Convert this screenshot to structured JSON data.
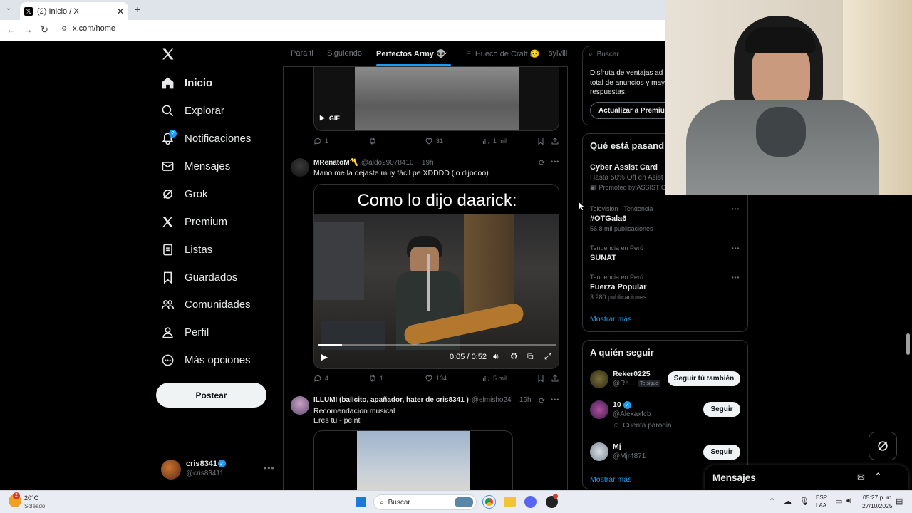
{
  "browser": {
    "tab_title": "(2) Inicio / X",
    "url": "x.com/home"
  },
  "nav": {
    "items": [
      "Inicio",
      "Explorar",
      "Notificaciones",
      "Mensajes",
      "Grok",
      "Premium",
      "Listas",
      "Guardados",
      "Comunidades",
      "Perfil",
      "Más opciones"
    ],
    "notif_badge": "2",
    "post_label": "Postear"
  },
  "account": {
    "name": "cris8341",
    "handle": "@cris83411"
  },
  "timeline_tabs": [
    "Para ti",
    "Siguiendo",
    "Perfectos Army 👽",
    "El Hueco de Craft 😥",
    "sylvill"
  ],
  "tweets": [
    {
      "media_badge": "GIF",
      "stats": {
        "replies": "1",
        "reposts": "",
        "likes": "31",
        "views": "1 mil"
      }
    },
    {
      "author": "MRenatoM〽️",
      "handle": "@aldo29078410",
      "time": "19h",
      "text": "Mano me la dejaste muy fácil pe XDDDD (lo dijoooo)",
      "video_caption": "Como lo dijo daarick:",
      "video_time": "0:05 / 0:52",
      "video_progress": 0.1,
      "stats": {
        "replies": "4",
        "reposts": "1",
        "likes": "134",
        "views": "5 mil"
      }
    },
    {
      "author": "ILLUMI (balicito, apañador, hater de cris8341 )",
      "handle": "@elmisho24",
      "time": "19h",
      "text1": "Recomendacion musical",
      "text2": "Eres tu - peint"
    }
  ],
  "search": {
    "placeholder": "Buscar"
  },
  "premium": {
    "lines": [
      "Disfruta de ventajas ad",
      "total de anuncios y may",
      "respuestas."
    ],
    "button": "Actualizar a Premiu"
  },
  "trends": {
    "title": "Qué está pasand",
    "items": [
      {
        "meta": "",
        "name": "Cyber Assist Card",
        "sub": "Hasta 50% Off en Asist",
        "promo": "Promoted by ASSIST C"
      },
      {
        "meta": "Televisión · Tendencia",
        "name": "#OTGala6",
        "sub": "56,8 mil publicaciones"
      },
      {
        "meta": "Tendencia en Perú",
        "name": "SUNAT",
        "sub": ""
      },
      {
        "meta": "Tendencia en Perú",
        "name": "Fuerza Popular",
        "sub": "3.280 publicaciones"
      }
    ],
    "show_more": "Mostrar más"
  },
  "who_to_follow": {
    "title": "A quién seguir",
    "items": [
      {
        "name": "Reker0225",
        "handle": "@Re...",
        "badge": "Te sigue",
        "button": "Seguir tú también",
        "note": ""
      },
      {
        "name": "10",
        "handle": "@Alexaxfcb",
        "badge": "",
        "button": "Seguir",
        "note": "Cuenta parodia"
      },
      {
        "name": "Mj",
        "handle": "@Mjr4871",
        "badge": "",
        "button": "Seguir",
        "note": ""
      }
    ],
    "show_more": "Mostrar más"
  },
  "messages_drawer": {
    "title": "Mensajes"
  },
  "taskbar": {
    "weather_temp": "20°C",
    "weather_desc": "Soleado",
    "weather_badge": "2",
    "search": "Buscar",
    "lang1": "ESP",
    "lang2": "LAA",
    "time": "05:27 p. m.",
    "date": "27/10/2025"
  },
  "colors": {
    "accent": "#1d9bf0",
    "background": "#000000",
    "border": "#2f3336"
  }
}
